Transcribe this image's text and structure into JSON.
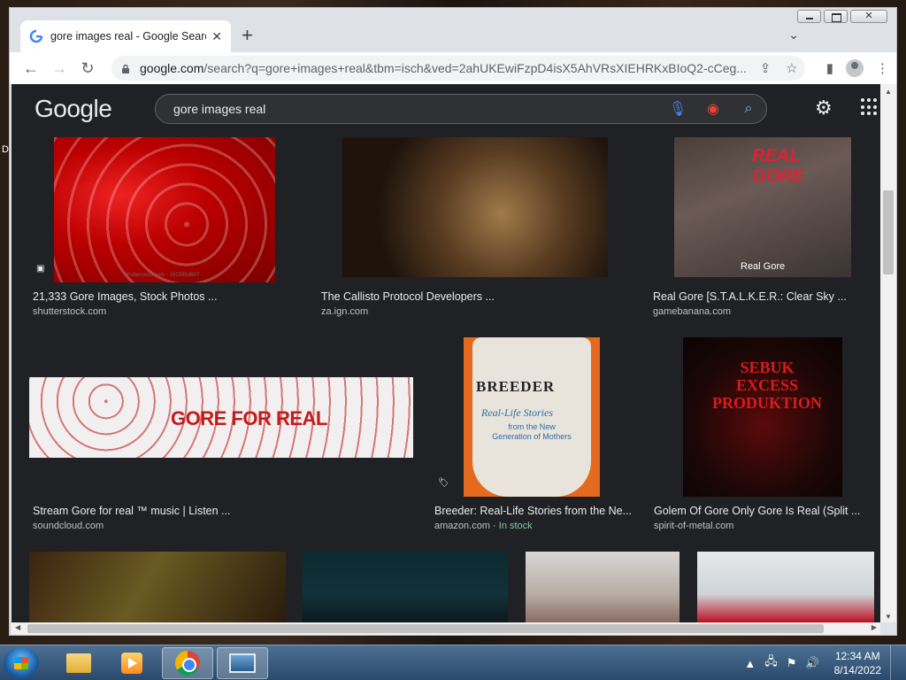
{
  "browser": {
    "tab_title": "gore images real - Google Search",
    "url_host": "google.com",
    "url_path": "/search?q=gore+images+real&tbm=isch&ved=2ahUKEwiFzpD4isX5AhVRsXIEHRKxBIoQ2-cCeg..."
  },
  "google": {
    "logo": "Google",
    "query": "gore images real"
  },
  "results_row1": [
    {
      "caption": "21,333 Gore Images, Stock Photos ...",
      "site": "shutterstock.com",
      "watermark": "shutterstock.com · 1915854667"
    },
    {
      "caption": "The Callisto Protocol Developers ...",
      "site": "za.ign.com"
    },
    {
      "caption": "Real Gore [S.T.A.L.K.E.R.: Clear Sky ...",
      "site": "gamebanana.com",
      "overlay": "Real Gore",
      "image_title": "REAL GORE"
    }
  ],
  "results_row2": [
    {
      "caption": "Stream Gore for real ™ music | Listen ...",
      "site": "soundcloud.com",
      "image_text": "GORE FOR REAL"
    },
    {
      "caption": "Breeder: Real-Life Stories from the Ne...",
      "site": "amazon.com",
      "stock": "In stock",
      "separator": " · ",
      "image_title": "BREEDER",
      "image_sub": "Real-Life Stories",
      "image_small": "from the New Generation of Mothers"
    },
    {
      "caption": "Golem Of Gore Only Gore Is Real (Split ...",
      "site": "spirit-of-metal.com",
      "image_text": "SEBUK EXCESS PRODUKTION"
    }
  ],
  "taskbar": {
    "time": "12:34 AM",
    "date": "8/14/2022"
  },
  "desktop": {
    "edge_text": "D"
  }
}
